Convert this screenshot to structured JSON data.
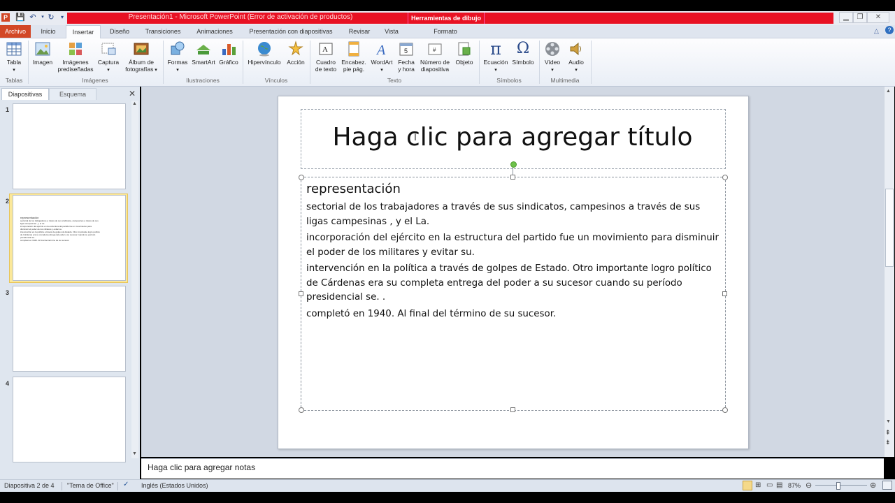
{
  "window": {
    "title": "Presentación1 - Microsoft PowerPoint (Error de activación de productos)",
    "context_tab": "Herramientas de dibujo",
    "app_icon": "P"
  },
  "tabs": [
    "Archivo",
    "Inicio",
    "Insertar",
    "Diseño",
    "Transiciones",
    "Animaciones",
    "Presentación con diapositivas",
    "Revisar",
    "Vista",
    "Formato"
  ],
  "ribbon": {
    "tabla": "Tabla",
    "imagen": "Imagen",
    "imagenes_1": "Imágenes",
    "imagenes_2": "prediseñadas",
    "captura": "Captura",
    "album_1": "Álbum de",
    "album_2": "fotografías",
    "formas": "Formas",
    "smartart": "SmartArt",
    "grafico": "Gráfico",
    "hipervinculo": "Hipervínculo",
    "accion": "Acción",
    "cuadro_1": "Cuadro",
    "cuadro_2": "de texto",
    "encabez_1": "Encabez.",
    "encabez_2": "pie pág.",
    "wordart": "WordArt",
    "fecha_1": "Fecha",
    "fecha_2": "y hora",
    "numero_1": "Número de",
    "numero_2": "diapositiva",
    "objeto": "Objeto",
    "ecuacion": "Ecuación",
    "simbolo": "Símbolo",
    "video": "Vídeo",
    "audio": "Audio",
    "groups": {
      "tablas": "Tablas",
      "imagenes": "Imágenes",
      "ilustraciones": "Ilustraciones",
      "vinculos": "Vínculos",
      "texto": "Texto",
      "simbolos": "Símbolos",
      "multimedia": "Multimedia"
    }
  },
  "left_pane": {
    "tab_slides": "Diapositivas",
    "tab_outline": "Esquema",
    "slide_numbers": [
      "1",
      "2",
      "3",
      "4"
    ],
    "thumb2_lines": [
      "representación",
      "sectorial de los trabajadores a través de sus sindicatos, campesinos a través de sus",
      "ligas campesinas , y el La.",
      "incorporación del ejército en la estructura del partido fue un movimiento para",
      "disminuir el poder de los militares y evitar su.",
      "intervención en la política a través de golpes de Estado. Otro importante logro político",
      "de Cárdenas era su completa entrega del poder a su sucesor cuando su período",
      "presidencial se. .",
      "completó en 1940. Al final del término de su sucesor."
    ]
  },
  "slide": {
    "title_placeholder": "Haga clic para agregar título",
    "body_heading": "representación",
    "paragraphs": [
      "sectorial de los trabajadores a través de sus sindicatos, campesinos a través de sus ligas campesinas , y el La.",
      "incorporación del ejército en la estructura del partido fue un movimiento para disminuir el poder de los militares y evitar su.",
      "intervención en la política a través de golpes de Estado. Otro importante logro político de Cárdenas era su completa entrega del poder a su sucesor cuando su período presidencial se. .",
      "completó en 1940. Al final del término de su sucesor."
    ]
  },
  "notes": {
    "placeholder": "Haga clic para agregar notas"
  },
  "status": {
    "slide_info": "Diapositiva 2 de 4",
    "theme": "\"Tema de Office\"",
    "language": "Inglés (Estados Unidos)",
    "zoom": "87%"
  }
}
